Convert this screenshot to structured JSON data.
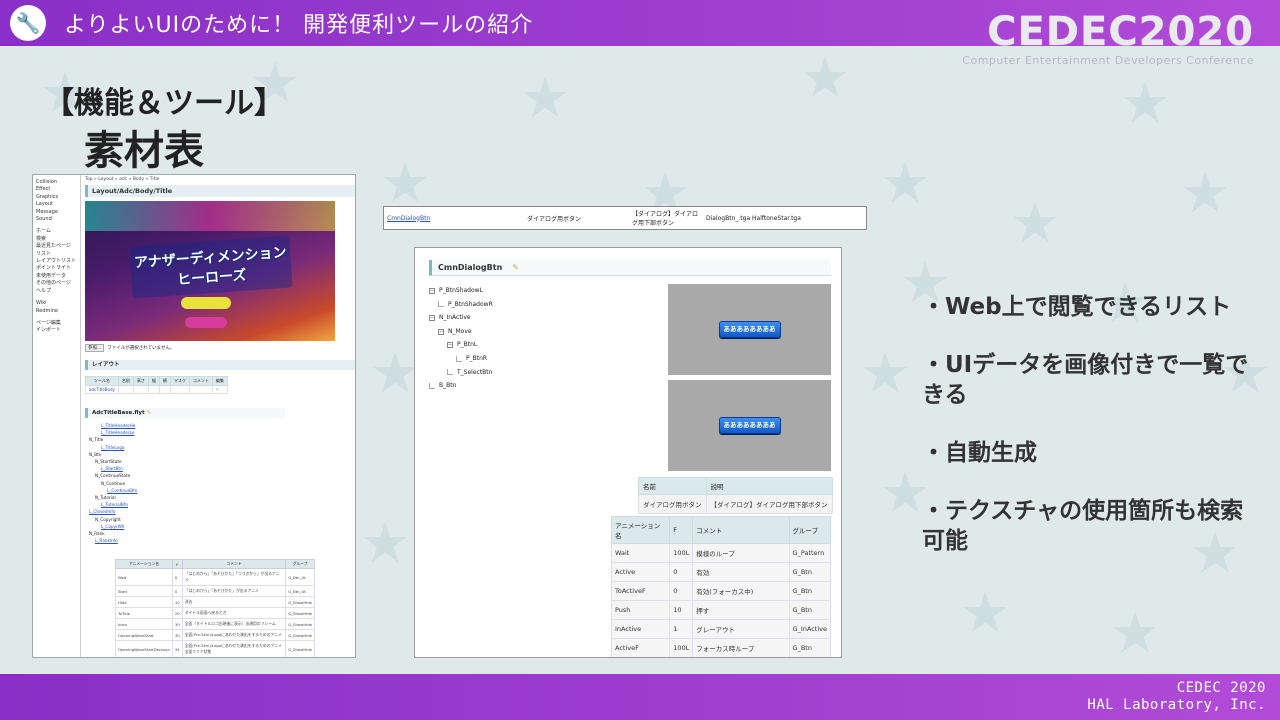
{
  "header": {
    "title": "よりよいUIのために！ 開発便利ツールの紹介",
    "icon": "wrench-icon"
  },
  "logo": {
    "main": "CEDEC2020",
    "sub": "Computer Entertainment Developers Conference"
  },
  "section": {
    "title": "【機能＆ツール】",
    "subtitle": "素材表"
  },
  "left_shot": {
    "sidebar": [
      "Collision",
      "Effect",
      "Graphics",
      "Layout",
      "Message",
      "Sound",
      "",
      "ホーム",
      "検索",
      "最近見たページ",
      "リスト",
      "レイアウトリスト",
      "ポイントライト",
      "未使用データ",
      "その他のページ",
      "ヘルプ",
      "",
      "Wiki",
      "Redmine",
      "",
      "ページ編集",
      "インポート"
    ],
    "crumb": "Top » Layout » adc » Body » Title",
    "heading": "Layout/Adc/Body/Title",
    "game_logo": "アナザーディメンションヒーローズ",
    "file_button": "参照...",
    "file_text": "ファイルが選択されていません。",
    "layout_heading": "レイアウト",
    "layout_table": {
      "headers": [
        "ツール名",
        "名前",
        "高さ",
        "幅",
        "横",
        "マスク",
        "コメント",
        "編集"
      ],
      "row": [
        "adcTitleBody"
      ]
    },
    "tree_heading": "AdcTitleBase.flyt",
    "tree": [
      "L_TitleHeaderHe",
      "L_TitleHeaderLe",
      "N_Title",
      "L_TitleLogo",
      "N_Btn",
      "N_StartState",
      "L_StartBtn",
      "N_ContinueState",
      "N_Continue",
      "L_ContinueBtn",
      "N_Tutorial",
      "L_TutorialBtn",
      "L_ClosedInfo",
      "N_Copyright",
      "L_CopyrWII",
      "N_Rank",
      "L_RankInfo"
    ],
    "anim_headers": [
      "アニメーション名",
      "F",
      "コメント",
      "グループ"
    ],
    "anim_rows": [
      [
        "Wait",
        "0",
        "「はじめから」「あそびかた」「つづきから」が出るアニメ",
        "G_Btn_Ut"
      ],
      [
        "Start",
        "0",
        "「はじめから」「あそびかた」が出るアニメ",
        "G_Btn_Ut"
      ],
      [
        "Hide",
        "10",
        "消去",
        "G_ShowHide"
      ],
      [
        "ToTitle",
        "20",
        "タイトル画面へ戻るとき",
        "G_ShowHide"
      ],
      [
        "Intro",
        "30",
        "全面（タイトルロゴ出現後に表示）出現用のフレーム",
        "G_ShowHide"
      ],
      [
        "OpeningWaveStart",
        "30",
        "全面(Pre-Skin)/Logoにあわせた演出をするためのアニメ",
        "G_ShowHide"
      ],
      [
        "OpeningWaveStartDecision",
        "34",
        "全面(Pre-Skin)/Logoにあわせた演出をするためのアニメ 全面クリア状態",
        "G_ShowHide"
      ]
    ]
  },
  "top_row": [
    "CmnDialogBtn",
    "ダイアログ用ボタン",
    "【ダイアログ】ダイアログ用下部ボタン",
    "DialogBtn_.tga HalftoneStar.tga"
  ],
  "mid_shot": {
    "heading": "CmnDialogBtn",
    "tree": [
      {
        "label": "P_BtnShadowL",
        "indent": 0,
        "toggle": "⊟"
      },
      {
        "label": "P_BtnShadowR",
        "indent": 1,
        "toggle": ""
      },
      {
        "label": "N_InActive",
        "indent": 0,
        "toggle": "⊟"
      },
      {
        "label": "N_Move",
        "indent": 1,
        "toggle": "⊟"
      },
      {
        "label": "P_BtnL",
        "indent": 2,
        "toggle": "⊟"
      },
      {
        "label": "P_BtnR",
        "indent": 3,
        "toggle": ""
      },
      {
        "label": "T_SelectBtn",
        "indent": 2,
        "toggle": ""
      },
      {
        "label": "B_Btn",
        "indent": 0,
        "toggle": ""
      }
    ],
    "preview_text": "ああああああああ",
    "name_headers": [
      "名前",
      "説明"
    ],
    "name_row": [
      "ダイアログ用ボタン",
      "【ダイアログ】ダイアログ用下部ボタン"
    ],
    "anim_headers": [
      "アニメーション名",
      "F",
      "コメント",
      "グループ"
    ],
    "anim_rows": [
      [
        "Wait",
        "100L",
        "模様のループ",
        "G_Pattern"
      ],
      [
        "Active",
        "0",
        "有効",
        "G_Btn"
      ],
      [
        "ToActiveF",
        "0",
        "有効(フォーカス中)",
        "G_Btn"
      ],
      [
        "Push",
        "10",
        "押す",
        "G_Btn"
      ],
      [
        "InActive",
        "1",
        "グレーアウト",
        "G_InActive"
      ],
      [
        "ActiveF",
        "100L",
        "フォーカス時ループ",
        "G_Btn"
      ],
      [
        "ToActive",
        "1",
        "フォーカス時ループからActive",
        "G_Btn"
      ]
    ]
  },
  "bullets": [
    "・Web上で閲覧できるリスト",
    "・UIデータを画像付きで一覧できる",
    "・自動生成",
    "・テクスチャの使用箇所も検索可能"
  ],
  "footer": {
    "line1": "CEDEC 2020",
    "line2": "HAL Laboratory, Inc."
  }
}
